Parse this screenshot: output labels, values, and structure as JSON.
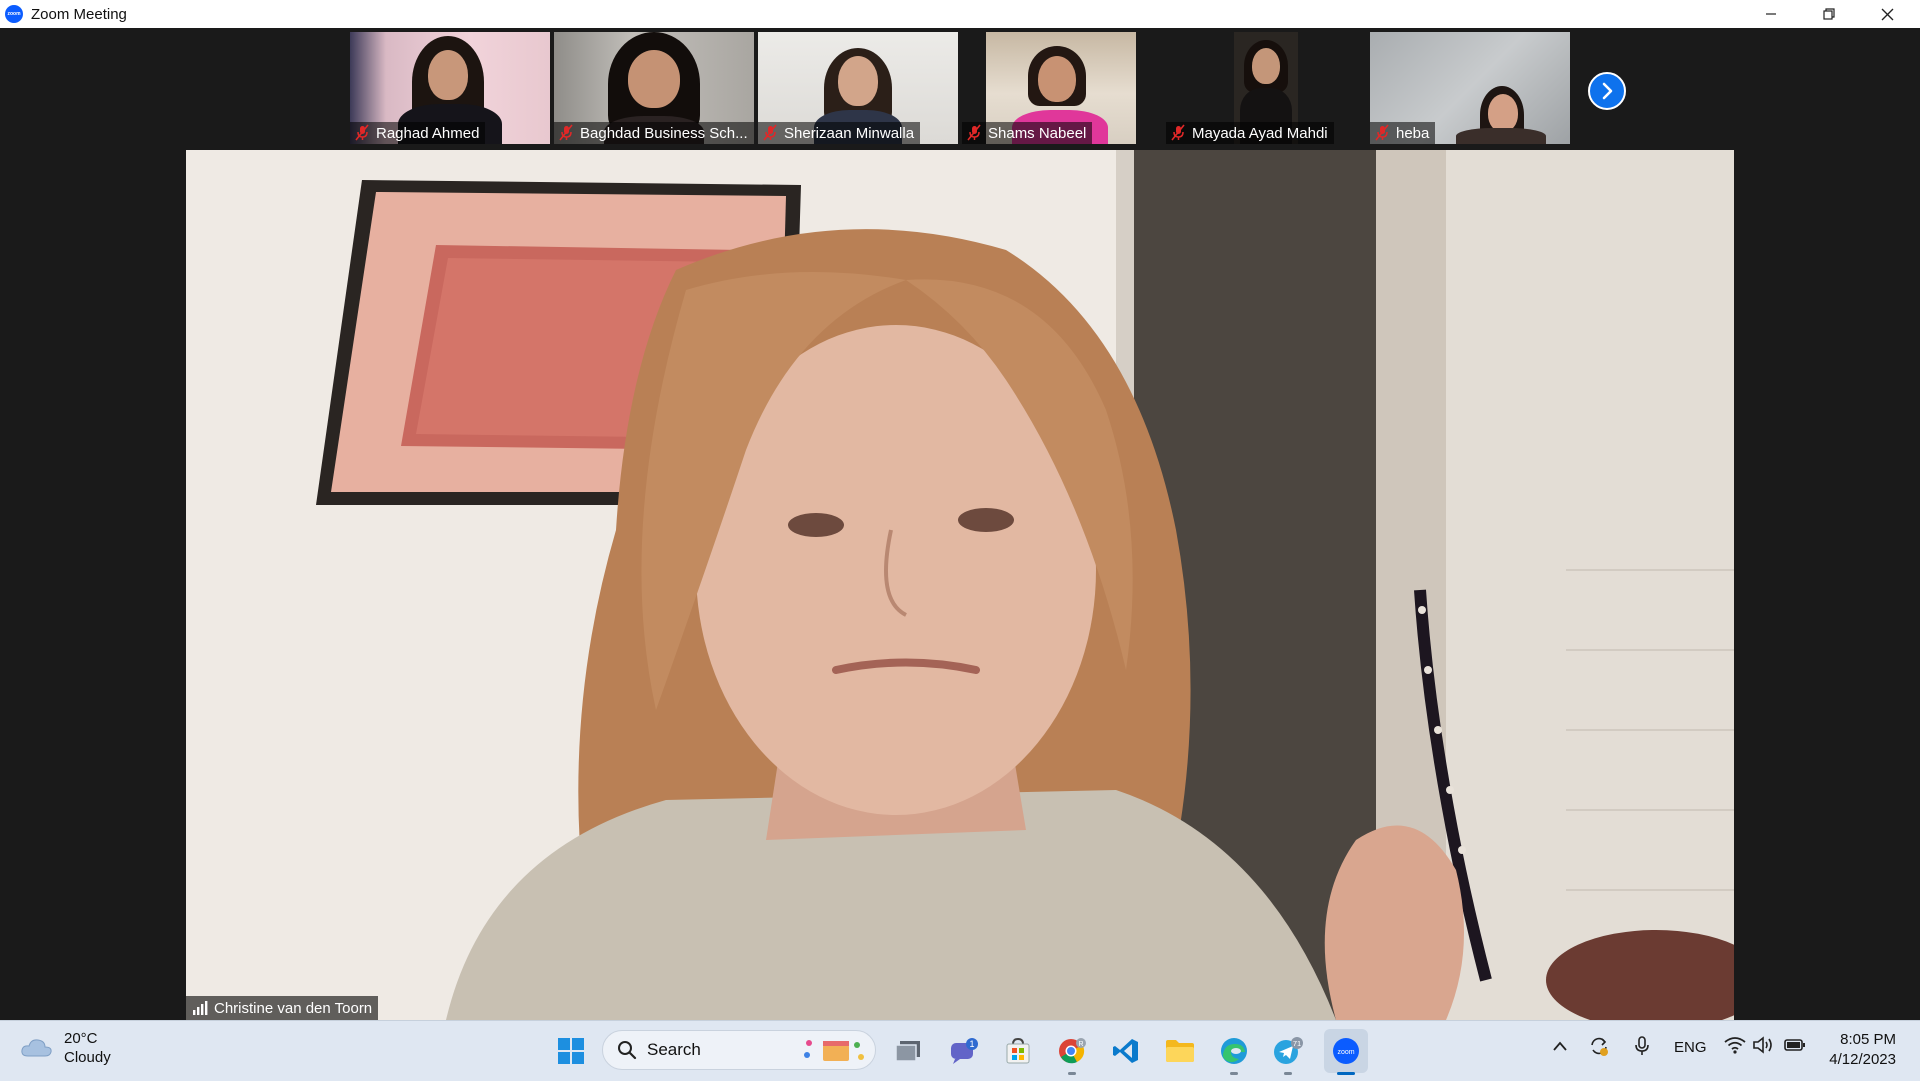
{
  "window": {
    "title": "Zoom Meeting",
    "logo_text": "zoom"
  },
  "colors": {
    "zoom_blue": "#0e72ed",
    "muted_red": "#e02828",
    "meeting_bg": "#1a1a1a",
    "taskbar_bg": "#dfe7f2"
  },
  "participants": [
    {
      "name": "Raghad Ahmed",
      "muted": true
    },
    {
      "name": "Baghdad Business Sch...",
      "muted": true
    },
    {
      "name": "Sherizaan Minwalla",
      "muted": true
    },
    {
      "name": "Shams Nabeel",
      "muted": true
    },
    {
      "name": "Mayada Ayad Mahdi",
      "muted": true
    },
    {
      "name": "heba",
      "muted": true
    }
  ],
  "next_page_icon": "chevron-right-icon",
  "speaker": {
    "name": "Christine van den Toorn",
    "signal_icon": "signal-bars-icon"
  },
  "taskbar": {
    "weather": {
      "temp": "20°C",
      "condition": "Cloudy",
      "icon": "cloud-icon"
    },
    "search_label": "Search",
    "apps": [
      {
        "name": "start",
        "icon": "windows-start-icon"
      },
      {
        "name": "task-view",
        "icon": "task-view-icon"
      },
      {
        "name": "teams-chat",
        "icon": "chat-icon",
        "badge": "1"
      },
      {
        "name": "microsoft-store",
        "icon": "store-icon"
      },
      {
        "name": "chrome",
        "icon": "chrome-icon",
        "badge": "R"
      },
      {
        "name": "vscode",
        "icon": "vscode-icon"
      },
      {
        "name": "file-explorer",
        "icon": "folder-icon"
      },
      {
        "name": "edge",
        "icon": "edge-icon"
      },
      {
        "name": "telegram",
        "icon": "telegram-icon",
        "badge": "71"
      },
      {
        "name": "zoom",
        "icon": "zoom-icon",
        "label": "zoom"
      }
    ],
    "tray": {
      "language": "ENG",
      "time": "8:05 PM",
      "date": "4/12/2023"
    }
  }
}
